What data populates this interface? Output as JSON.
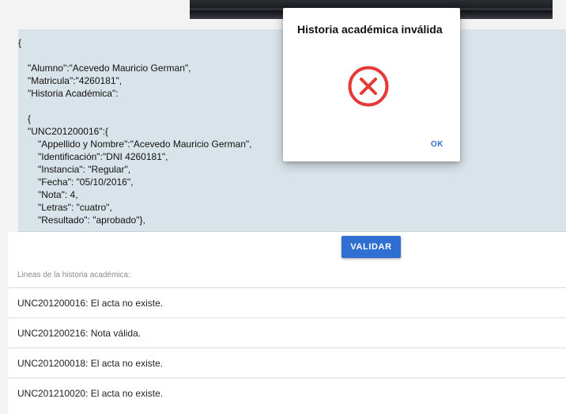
{
  "json_text": {
    "lines": [
      "{",
      "\"Alumno\":\"Acevedo Mauricio German\",",
      "\"Matricula\":\"4260181\",",
      "\"Historia Académica\":",
      "{",
      "\"UNC201200016\":{",
      "\"Appellido y Nombre\":\"Acevedo Mauricio German\",",
      "\"Identificación\":\"DNI 4260181\",",
      "\"Instancia\": \"Regular\",",
      "\"Fecha\": \"05/10/2016\",",
      "\"Nota\": 4,",
      "\"Letras\": \"cuatro\",",
      "\"Resultado\": \"aprobado\"},"
    ]
  },
  "validate_button": {
    "label": "VALIDAR"
  },
  "results": {
    "label": "Lineas de la historia académica:",
    "rows": [
      "UNC201200016: El acta no existe.",
      "UNC201200216: Nota válida.",
      "UNC201200018: El acta no existe.",
      "UNC201210020: El acta no existe."
    ]
  },
  "dialog": {
    "title": "Historia académica inválida",
    "icon": "error-circle-x-icon",
    "ok_label": "OK"
  },
  "colors": {
    "accent": "#2f6fd1",
    "error": "#e53935",
    "json_background": "#d9e4ea"
  }
}
